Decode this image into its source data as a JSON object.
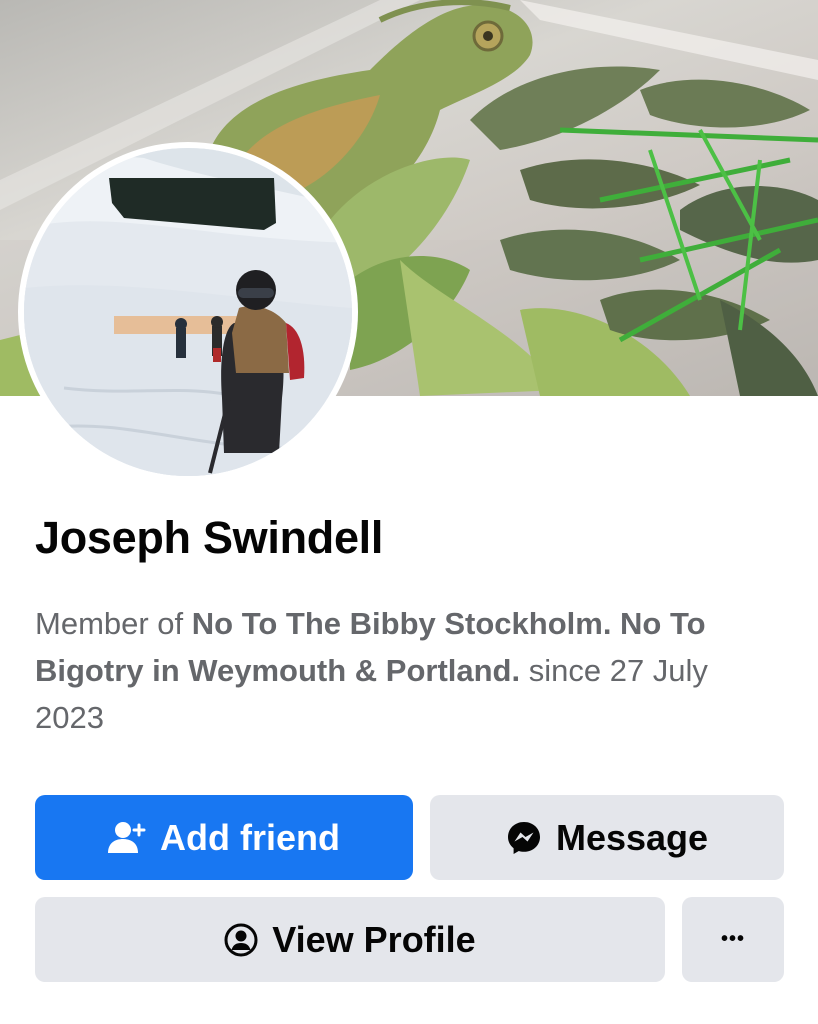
{
  "profile": {
    "name": "Joseph Swindell",
    "membership": {
      "prefix": "Member of ",
      "group": "No To The Bibby Stockholm. No To Bigotry in Weymouth & Portland.",
      "suffix": " since 27 July 2023"
    }
  },
  "images": {
    "cover": "cover-photo-chameleon-on-leaves",
    "avatar": "profile-photo-skier-in-snow"
  },
  "actions": {
    "add_friend": {
      "label": "Add friend",
      "icon": "add-friend-icon"
    },
    "message": {
      "label": "Message",
      "icon": "messenger-icon"
    },
    "view_profile": {
      "label": "View Profile",
      "icon": "profile-circle-icon"
    },
    "more": {
      "label": "•••",
      "icon": "more-icon"
    }
  },
  "colors": {
    "primary": "#1877f2",
    "secondary_button": "#e4e6eb",
    "text_primary": "#050505",
    "text_secondary": "#65676b"
  }
}
